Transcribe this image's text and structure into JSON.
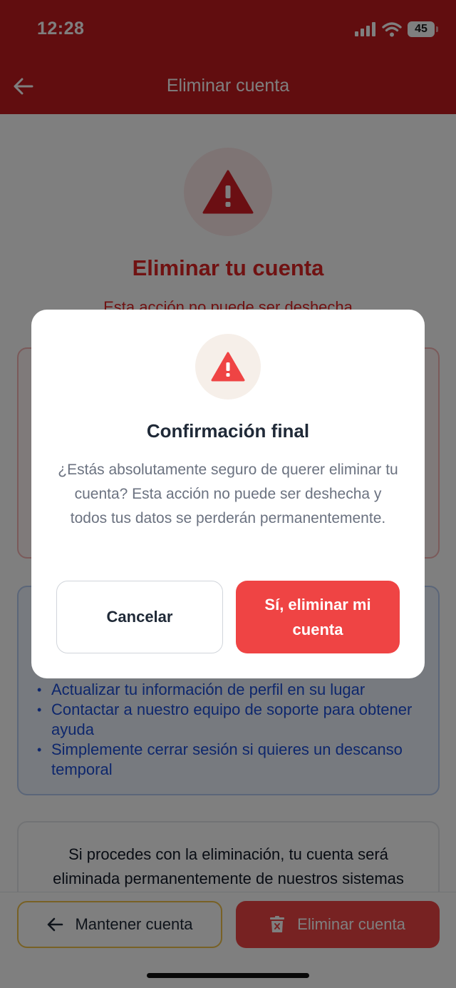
{
  "status_bar": {
    "time": "12:28",
    "battery": "45",
    "icons": [
      "signal-icon",
      "wifi-icon",
      "battery-icon"
    ]
  },
  "header": {
    "title": "Eliminar cuenta",
    "back_icon": "arrow-left-icon"
  },
  "page": {
    "heading": "Eliminar tu cuenta",
    "subtitle": "Esta acción no puede ser deshecha",
    "alternatives": [
      "Actualizar tu información de perfil en su lugar",
      "Contactar a nuestro equipo de soporte para obtener ayuda",
      "Simplemente cerrar sesión si quieres un descanso temporal"
    ],
    "note": "Si procedes con la eliminación, tu cuenta será eliminada permanentemente de nuestros sistemas"
  },
  "bottom_bar": {
    "keep_label": "Mantener cuenta",
    "delete_label": "Eliminar cuenta"
  },
  "modal": {
    "title": "Confirmación final",
    "message": "¿Estás absolutamente seguro de querer eliminar tu cuenta? Esta acción no puede ser deshecha y todos tus datos se perderán permanentemente.",
    "cancel_label": "Cancelar",
    "confirm_label": "Sí, eliminar mi cuenta"
  },
  "colors": {
    "header": "#c21a1f",
    "danger": "#ef4444",
    "danger_text": "#e02424",
    "info_text": "#1d4ed8",
    "keep_border": "#f0c34a"
  }
}
